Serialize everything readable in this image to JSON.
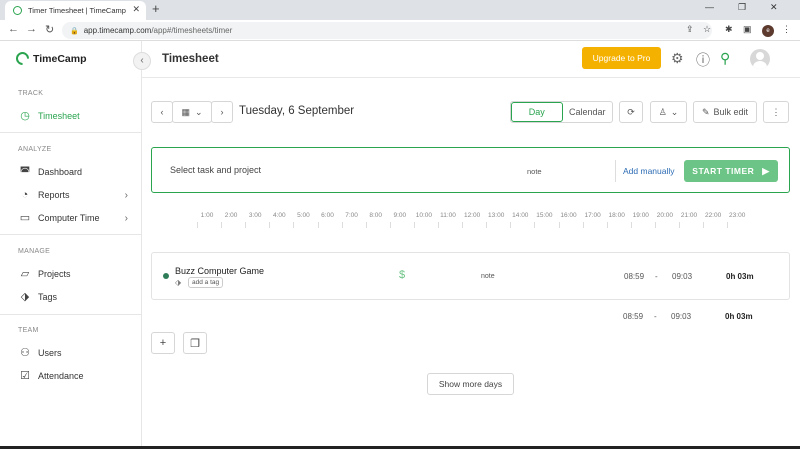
{
  "browser": {
    "tab_title": "Timer Timesheet | TimeCamp",
    "tab_close": "✕",
    "new_tab": "+",
    "minimize": "—",
    "restore": "❐",
    "close": "✕",
    "url_host": "app.timecamp.com",
    "url_path": "/app#/timesheets/timer",
    "profile_initial": "e"
  },
  "sidebar": {
    "brand": "TimeCamp",
    "sections": [
      {
        "title": "TRACK",
        "items": [
          {
            "label": "Timesheet",
            "icon": "clock-icon",
            "active": true
          }
        ]
      },
      {
        "title": "ANALYZE",
        "items": [
          {
            "label": "Dashboard",
            "icon": "dashboard-icon"
          },
          {
            "label": "Reports",
            "icon": "pie-chart-icon",
            "has_submenu": true
          },
          {
            "label": "Computer Time",
            "icon": "monitor-icon",
            "has_submenu": true
          }
        ]
      },
      {
        "title": "MANAGE",
        "items": [
          {
            "label": "Projects",
            "icon": "folder-icon"
          },
          {
            "label": "Tags",
            "icon": "tag-icon"
          }
        ]
      },
      {
        "title": "TEAM",
        "items": [
          {
            "label": "Users",
            "icon": "users-icon"
          },
          {
            "label": "Attendance",
            "icon": "checkbox-icon"
          }
        ]
      }
    ]
  },
  "header": {
    "title": "Timesheet",
    "upgrade_label": "Upgrade to Pro"
  },
  "toolbar": {
    "date": "Tuesday, 6 September",
    "view_day": "Day",
    "view_calendar": "Calendar",
    "bulk_edit": "Bulk edit"
  },
  "timer": {
    "task_placeholder": "Select task and project",
    "note_placeholder": "note",
    "add_manually": "Add manually",
    "start_label": "START TIMER"
  },
  "hours": [
    "1:00",
    "2:00",
    "3:00",
    "4:00",
    "5:00",
    "6:00",
    "7:00",
    "8:00",
    "9:00",
    "10:00",
    "11:00",
    "12:00",
    "13:00",
    "14:00",
    "15:00",
    "16:00",
    "17:00",
    "18:00",
    "19:00",
    "20:00",
    "21:00",
    "22:00",
    "23:00"
  ],
  "entry": {
    "task": "Buzz Computer Game",
    "tag_label": "add a tag",
    "billable_symbol": "$",
    "note": "note",
    "start": "08:59",
    "separator": "-",
    "end": "09:03",
    "duration": "0h 03m"
  },
  "summary": {
    "start": "08:59",
    "separator": "-",
    "end": "09:03",
    "duration": "0h 03m"
  },
  "actions": {
    "add_symbol": "+",
    "show_more": "Show more days"
  },
  "colors": {
    "brand_green": "#2aa44f",
    "upgrade_orange": "#f5b100",
    "start_button": "#6cc486",
    "link_blue": "#2d6cb5"
  }
}
